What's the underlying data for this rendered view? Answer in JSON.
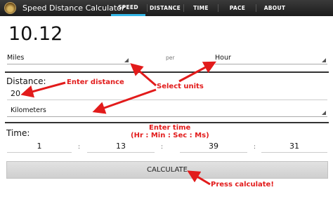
{
  "app": {
    "title": "Speed Distance Calculator"
  },
  "tabs": [
    {
      "label": "SPEED",
      "active": true
    },
    {
      "label": "DISTANCE",
      "active": false
    },
    {
      "label": "TIME",
      "active": false
    },
    {
      "label": "PACE",
      "active": false
    },
    {
      "label": "ABOUT",
      "active": false
    }
  ],
  "result": {
    "value": "10.12"
  },
  "speed_units": {
    "distance_unit": "Miles",
    "per_label": "per",
    "time_unit": "Hour"
  },
  "distance": {
    "label": "Distance:",
    "value": "20",
    "unit": "Kilometers"
  },
  "time": {
    "label": "Time:",
    "hours": "1",
    "minutes": "13",
    "seconds": "39",
    "milliseconds": "31",
    "separator": ":"
  },
  "calculate": {
    "label": "CALCULATE"
  },
  "annotations": {
    "enter_distance": "Enter distance",
    "select_units": "Select units",
    "enter_time": "Enter time",
    "time_format": "(Hr : Min : Sec : Ms)",
    "press_calculate": "Press calculate!"
  },
  "colors": {
    "accent": "#33b5e5",
    "annotation": "#e21b1b"
  }
}
